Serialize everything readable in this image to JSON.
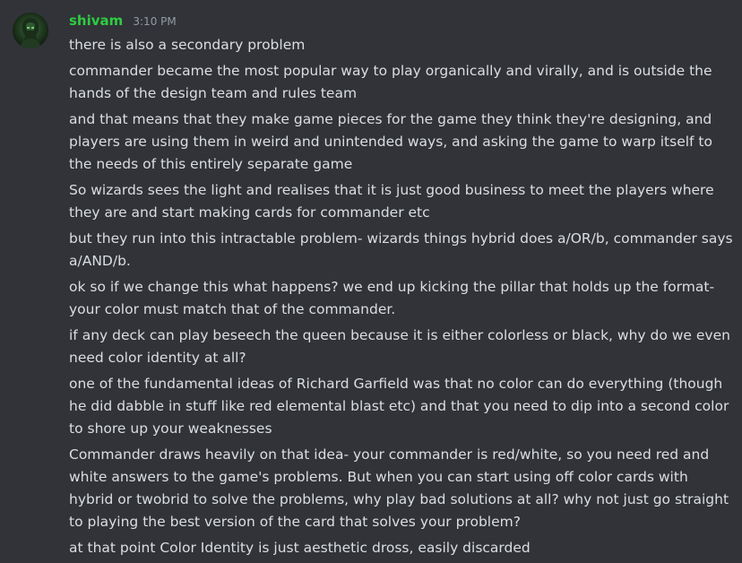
{
  "author": {
    "name": "shivam",
    "timestamp": "3:10 PM",
    "name_color": "#2ecc40"
  },
  "messages": [
    {
      "text": "there is also a secondary problem"
    },
    {
      "text": "commander became the most popular way to play organically and virally, and is outside the hands of the design team and rules team"
    },
    {
      "text": "and that means that they make game pieces for the game they think they're designing, and players are using them in weird and unintended ways, and asking the game to warp itself to the needs of this entirely separate game"
    },
    {
      "text": "So wizards sees the light and realises that it is just good business to meet the players where they are and start making cards for commander etc"
    },
    {
      "text": "but they run into this intractable problem- wizards things hybrid does a/OR/b, commander says a/AND/b."
    },
    {
      "text": "ok so if we change this what happens? we end up kicking the pillar that holds up the format- your color must match that of the commander."
    },
    {
      "text": "if any deck can play beseech the queen because it is either colorless or black, why do we even need color identity at all?"
    },
    {
      "text": "one of the fundamental ideas of Richard Garfield was that no color can do everything (though he did dabble in stuff like red elemental blast etc) and that you need to dip into a second color to shore up your weaknesses"
    },
    {
      "text": "Commander draws heavily on that idea- your commander is red/white, so  you need red and white answers to the game's problems. But when you can start using off color cards with hybrid or twobrid to solve the problems, why play bad solutions at all? why not just go straight to playing the best version of the card that solves your problem?"
    },
    {
      "text": "at that point Color Identity is just aesthetic dross, easily discarded"
    }
  ],
  "theme": {
    "background": "#313338",
    "text": "#dbdee1",
    "muted": "#949ba4"
  }
}
